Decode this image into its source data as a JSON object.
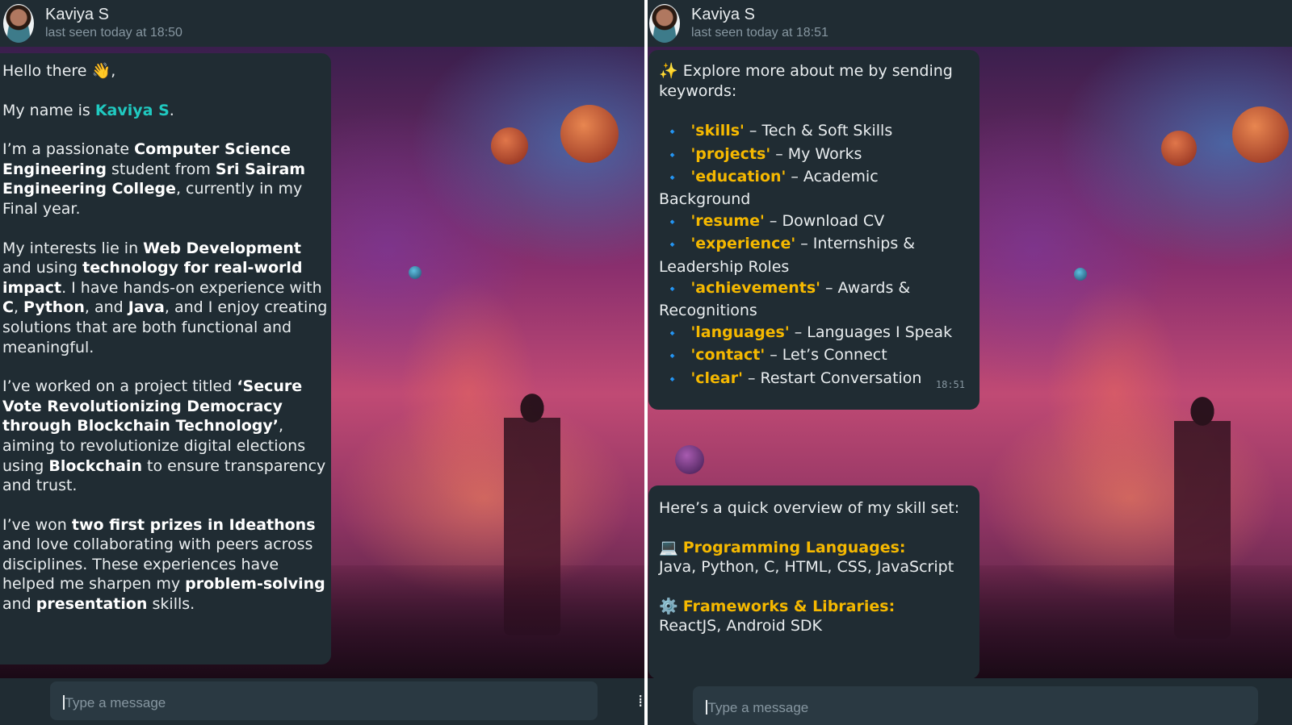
{
  "left": {
    "header": {
      "name": "Kaviya S",
      "status": "last seen today at 18:50"
    },
    "intro": {
      "greeting": "Hello there",
      "greeting_emoji": "👋",
      "greeting_end": ",",
      "name_prefix": "My name is ",
      "name": "Kaviya S",
      "name_suffix": ".",
      "p3_a": "I’m a passionate ",
      "p3_b": "Computer Science Engineering",
      "p3_c": " student from ",
      "p3_d": "Sri Sairam Engineering College",
      "p3_e": ", currently in my Final year.",
      "p4_a": "My interests lie in ",
      "p4_b": "Web Development",
      "p4_c": " and using ",
      "p4_d": "technology for real-world impact",
      "p4_e": ". I have hands-on experience with ",
      "p4_f": "C",
      "p4_g": ", ",
      "p4_h": "Python",
      "p4_i": ", and ",
      "p4_j": "Java",
      "p4_k": ", and I enjoy creating solutions that are both functional and meaningful.",
      "p5_a": "I’ve worked on a project titled ",
      "p5_b": "‘Secure Vote Revolutionizing Democracy through Blockchain Technology’",
      "p5_c": ", aiming to revolutionize digital elections using ",
      "p5_d": "Blockchain",
      "p5_e": " to ensure transparency and trust.",
      "p6_a": "I’ve won ",
      "p6_b": "two first prizes in Ideathons",
      "p6_c": " and love collaborating with peers across disciplines. These experiences have helped me sharpen my ",
      "p6_d": "problem-solving",
      "p6_e": " and ",
      "p6_f": "presentation",
      "p6_g": " skills."
    },
    "input_placeholder": "Type a message"
  },
  "right": {
    "header": {
      "name": "Kaviya S",
      "status": "last seen today at 18:51"
    },
    "menu": {
      "intro_emoji": "✨",
      "intro": "Explore more about me by sending keywords:",
      "bullet": "🔹",
      "items": [
        {
          "keyword": "'skills'",
          "desc": " – Tech & Soft Skills"
        },
        {
          "keyword": "'projects'",
          "desc": " – My Works"
        },
        {
          "keyword": "'education'",
          "desc": " – Academic Background"
        },
        {
          "keyword": "'resume'",
          "desc": " – Download CV"
        },
        {
          "keyword": "'experience'",
          "desc": " – Internships & Leadership Roles"
        },
        {
          "keyword": "'achievements'",
          "desc": " – Awards & Recognitions"
        },
        {
          "keyword": "'languages'",
          "desc": " – Languages I Speak"
        },
        {
          "keyword": "'contact'",
          "desc": " – Let’s Connect"
        },
        {
          "keyword": "'clear'",
          "desc": " – Restart Conversation"
        }
      ],
      "time": "18:51"
    },
    "skills": {
      "intro": "Here’s a quick overview of my skill set:",
      "s1_emoji": "💻",
      "s1_head": "Programming Languages:",
      "s1_body": "Java, Python, C, HTML, CSS, JavaScript",
      "s2_emoji": "⚙️",
      "s2_head": "Frameworks & Libraries:",
      "s2_body": "ReactJS, Android SDK"
    },
    "input_placeholder": "Type a message"
  },
  "colors": {
    "header_bg": "#202c33",
    "bubble_bg": "#202c33",
    "accent_teal": "#20c9c0",
    "keyword_yellow": "#f5b800",
    "input_bg": "#2a3942"
  }
}
